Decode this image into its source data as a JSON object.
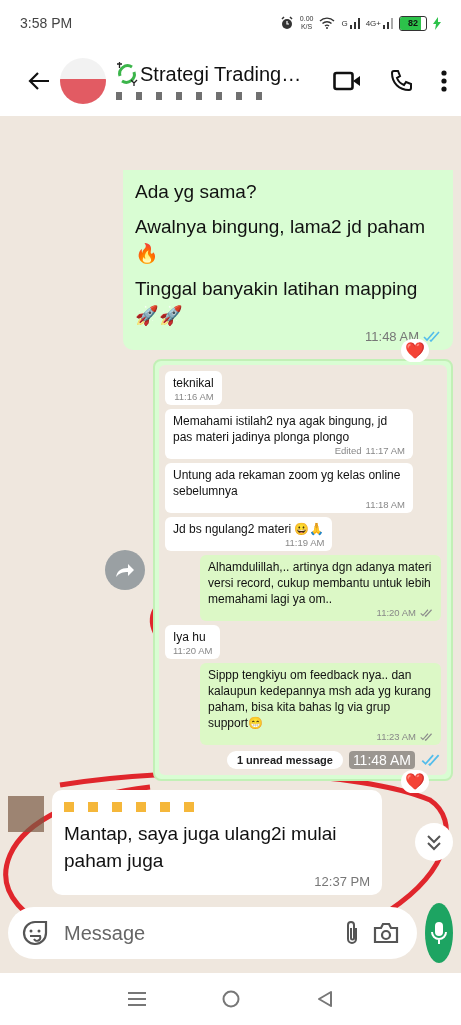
{
  "status_bar": {
    "time": "3:58 PM",
    "net_speed": "0.00",
    "net_unit": "K/S",
    "sim1": "G",
    "sim2": "4G+",
    "battery": {
      "text": "82",
      "level": 0.82,
      "charging": true
    }
  },
  "header": {
    "title": "Strategi Trading…"
  },
  "messages": [
    {
      "kind": "text",
      "outgoing": true,
      "paragraphs": [
        "Ada yg sama?",
        "Awalnya bingung, lama2 jd paham🔥",
        "Tinggal banyakin latihan mapping 🚀🚀"
      ],
      "time": "11:48 AM",
      "read": true,
      "reaction": "❤️"
    },
    {
      "kind": "screenshot",
      "outgoing": true,
      "items": [
        {
          "outgoing": false,
          "text": "teknikal",
          "time": "11:16 AM"
        },
        {
          "outgoing": false,
          "text": "Memahami istilah2 nya agak bingung, jd pas materi jadinya plonga plongo",
          "time": "11:17 AM",
          "edited": "Edited"
        },
        {
          "outgoing": false,
          "text": "Untung ada rekaman zoom yg kelas online sebelumnya",
          "time": "11:18 AM"
        },
        {
          "outgoing": false,
          "text": "Jd bs ngulang2 materi 😀🙏",
          "time": "11:19 AM"
        },
        {
          "outgoing": true,
          "text": "Alhamdulillah,.. artinya dgn adanya materi versi record, cukup membantu untuk lebih memahami lagi ya om..",
          "time": "11:20 AM",
          "read": false
        },
        {
          "outgoing": false,
          "text": "Iya hu",
          "time": "11:20 AM"
        },
        {
          "outgoing": true,
          "text": "Sippp tengkiyu om feedback nya.. dan kalaupun kedepannya msh ada yg kurang paham, bisa kita bahas lg via grup support😁",
          "time": "11:23 AM",
          "read": false
        }
      ],
      "unread": "1 unread message",
      "time": "11:48 AM",
      "read": true,
      "reaction": "❤️"
    },
    {
      "kind": "text",
      "outgoing": false,
      "paragraphs": [
        "Mantap, saya juga ulang2i mulai paham juga"
      ],
      "time": "12:37 PM"
    }
  ],
  "composer": {
    "placeholder": "Message"
  }
}
